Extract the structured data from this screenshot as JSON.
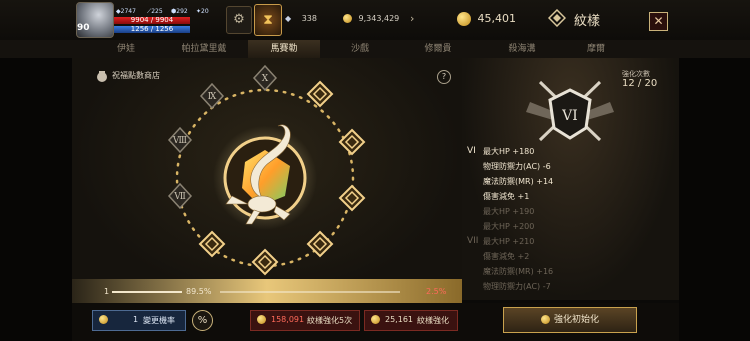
{
  "player": {
    "level": "90",
    "stat_a": "2747",
    "stat_b": "225",
    "stat_c": "292",
    "stat_d": "20",
    "hp": "9904 / 9904",
    "mp": "1256 / 1256"
  },
  "resources": {
    "crystal": "338",
    "gold": "9,343,429",
    "points": "45,401"
  },
  "header": {
    "title": "紋樣",
    "close_label": "✕"
  },
  "tabs": [
    "伊娃",
    "帕拉黛里戴",
    "馬賽勒",
    "沙戲",
    "修爾貴",
    "殺海溝",
    "摩爾"
  ],
  "active_tab": 2,
  "main": {
    "shop_label": "祝福點數商店",
    "help_label": "?"
  },
  "enhance": {
    "count_label": "強化次數",
    "count_value": "12 / 20",
    "emblem_numeral": "VI"
  },
  "stats": {
    "level_vi": "VI",
    "vi_lines": [
      "最大HP +180",
      "物理防禦力(AC) -6",
      "魔法防禦(MR) +14",
      "傷害減免 +1"
    ],
    "dim_lines_a": [
      "最大HP +190",
      "最大HP +200"
    ],
    "level_vii": "VII",
    "vii_lines": [
      "最大HP +210",
      "傷害減免 +2",
      "魔法防禦(MR) +16",
      "物理防禦力(AC) -7"
    ]
  },
  "progress": {
    "left_value": "1",
    "left_pct": "89.5%",
    "right_pct": "2.5%"
  },
  "bottom": {
    "rate_count": "1",
    "rate_label": "變更機率",
    "pct_icon": "%",
    "btn5_count": "158,091",
    "btn5_label": "紋樣強化5次",
    "btn1_count": "25,161",
    "btn1_label": "紋樣強化",
    "init_label": "強化初始化"
  },
  "colors": {
    "accent_gold": "#c9a24e",
    "hp_red": "#e02020",
    "mp_blue": "#3a7ce0"
  }
}
